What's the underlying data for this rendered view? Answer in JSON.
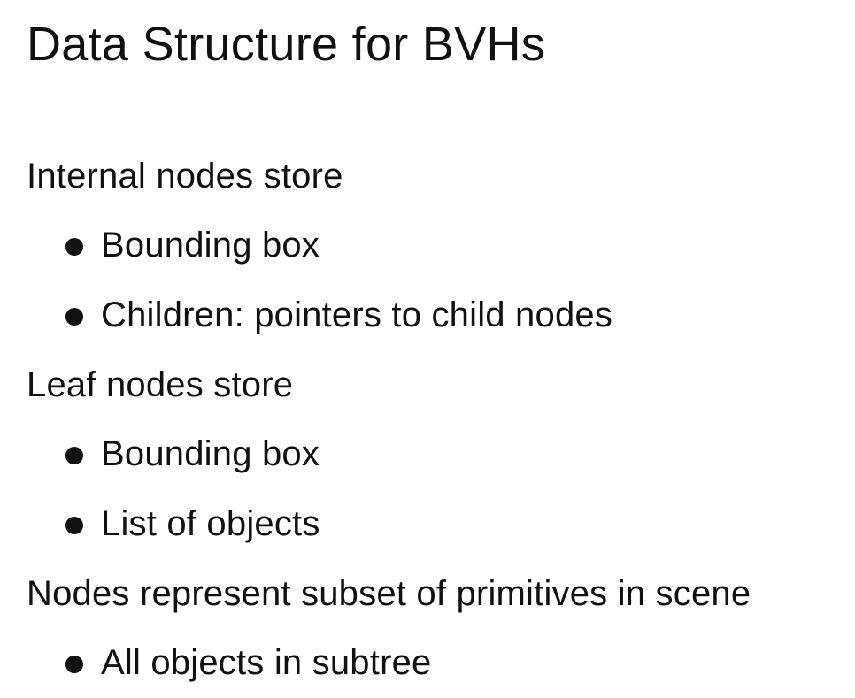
{
  "title": "Data Structure for BVHs",
  "sections": [
    {
      "heading": "Internal nodes store",
      "items": [
        "Bounding box",
        "Children: pointers to child nodes"
      ]
    },
    {
      "heading": "Leaf nodes store",
      "items": [
        "Bounding box",
        "List of objects"
      ]
    },
    {
      "heading": "Nodes represent subset of primitives in scene",
      "items": [
        "All objects in subtree"
      ]
    }
  ]
}
